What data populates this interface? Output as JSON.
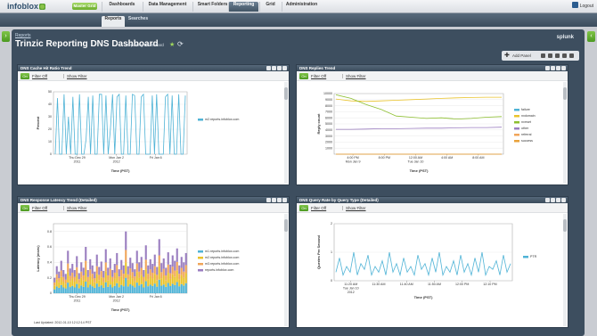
{
  "app": {
    "logo": "infoblox",
    "master_badge": "Master Grid",
    "logout": "Logout"
  },
  "nav": [
    {
      "label": "Dashboards",
      "active": false
    },
    {
      "label": "Data Management",
      "active": false
    },
    {
      "label": "Smart Folders",
      "active": false
    },
    {
      "label": "Reporting",
      "active": true
    },
    {
      "label": "Grid",
      "active": false
    },
    {
      "label": "Administration",
      "active": false
    }
  ],
  "subtabs": [
    {
      "label": "Reports",
      "active": true
    },
    {
      "label": "Searches",
      "active": false
    }
  ],
  "page": {
    "breadcrumb": "Reports",
    "title": "Trinzic Reporting DNS Dashboard",
    "sublabel": "Reporting Dashboard",
    "brand": "splunk",
    "add_panel": "Add Panel"
  },
  "filter": {
    "off": "Filter Off",
    "show": "Show Filter",
    "button": "On"
  },
  "panels": [
    {
      "title": "DNS Cache Hit Ratio Trend"
    },
    {
      "title": "DNS Replies Trend"
    },
    {
      "title": "DNS Response Latency Trend (Detailed)",
      "updated": "Last Updated: 2012-01-10 12:12:14 PST"
    },
    {
      "title": "DNS Query Rate by Query Type (Detailed)"
    }
  ],
  "colors": {
    "series_blue": "#4fb3d6",
    "series_yellow": "#e9c32c",
    "series_green": "#8dbf2f",
    "series_purple": "#9b7ec0",
    "series_orange": "#f0a55a",
    "series_teal": "#4fb3d6"
  },
  "chart_data": [
    {
      "type": "line",
      "title": "DNS Cache Hit Ratio Trend",
      "xlabel": "Time (PST)",
      "ylabel": "Percent",
      "ylim": [
        0,
        50
      ],
      "yticks": [
        0,
        10,
        20,
        30,
        40,
        50
      ],
      "xticks": [
        "Thu Dec 29\n2011",
        "Mon Jan 2\n2012",
        "Fri Jan 6"
      ],
      "series": [
        {
          "name": "m2.reports.infoblox.com",
          "color": "#4fb3d6",
          "values": [
            0,
            45,
            0,
            0,
            48,
            0,
            30,
            0,
            46,
            0,
            0,
            48,
            0,
            0,
            12,
            46,
            0,
            47,
            0,
            0,
            48,
            48,
            0,
            47,
            0,
            20,
            48,
            0,
            46,
            48,
            0,
            0,
            47,
            0,
            0,
            48,
            47,
            0,
            0,
            46,
            48,
            0,
            0,
            0,
            47,
            0,
            48,
            0,
            0,
            0,
            46,
            48,
            0,
            47,
            0,
            0,
            48,
            0,
            0,
            47
          ]
        }
      ]
    },
    {
      "type": "line",
      "title": "DNS Replies Trend",
      "xlabel": "Time (PST)",
      "ylabel": "Reply count",
      "ylim": [
        0,
        10000
      ],
      "yticks": [
        1000,
        2000,
        3000,
        4000,
        5000,
        6000,
        7000,
        8000,
        9000,
        10000
      ],
      "xticks": [
        "4:00 PM\nMon Jan 9",
        "8:00 PM",
        "12:00 AM\nTue Jan 10",
        "4:00 AM",
        "8:00 AM"
      ],
      "series": [
        {
          "name": "failure",
          "color": "#4fb3d6",
          "values": [
            0,
            0,
            0,
            0,
            0,
            0,
            0,
            0,
            0,
            0,
            0,
            0
          ]
        },
        {
          "name": "nxdomain",
          "color": "#e9c32c",
          "values": [
            9100,
            8800,
            8700,
            8800,
            8900,
            9000,
            9100,
            9200,
            9300,
            9350,
            9400,
            9400
          ]
        },
        {
          "name": "nxrrset",
          "color": "#8dbf2f",
          "values": [
            9800,
            9200,
            8200,
            7400,
            6300,
            6100,
            5900,
            6000,
            5800,
            5900,
            6100,
            6200
          ]
        },
        {
          "name": "other",
          "color": "#9b7ec0",
          "values": [
            4100,
            4100,
            4150,
            4200,
            4200,
            4250,
            4300,
            4300,
            4350,
            4400,
            4400,
            4450
          ]
        },
        {
          "name": "referral",
          "color": "#f0a55a",
          "values": [
            0,
            0,
            0,
            0,
            0,
            0,
            0,
            0,
            0,
            0,
            0,
            0
          ]
        },
        {
          "name": "success",
          "color": "#e9a23b",
          "values": [
            0,
            0,
            0,
            0,
            0,
            0,
            0,
            0,
            0,
            0,
            0,
            0
          ]
        }
      ]
    },
    {
      "type": "bar",
      "title": "DNS Response Latency Trend (Detailed)",
      "xlabel": "Time (PST)",
      "ylabel": "Latency (msec)",
      "ylim": [
        0,
        0.9
      ],
      "yticks": [
        0,
        0.2,
        0.4,
        0.6,
        0.8
      ],
      "xticks": [
        "Thu Dec 29\n2011",
        "Mon Jan 2\n2012",
        "Fri Jan 6"
      ],
      "series": [
        {
          "name": "m1.reports.infoblox.com",
          "color": "#4fb3d6"
        },
        {
          "name": "m2.reports.infoblox.com",
          "color": "#e9c32c"
        },
        {
          "name": "m3.reports.infoblox.com",
          "color": "#f0a55a"
        },
        {
          "name": "reports.infoblox.com",
          "color": "#9b7ec0"
        }
      ],
      "values": [
        0.2,
        0.35,
        0.28,
        0.42,
        0.3,
        0.25,
        0.55,
        0.32,
        0.38,
        0.3,
        0.48,
        0.26,
        0.4,
        0.33,
        0.6,
        0.3,
        0.44,
        0.36,
        0.28,
        0.5,
        0.34,
        0.41,
        0.29,
        0.57,
        0.33,
        0.45,
        0.3,
        0.38,
        0.52,
        0.31,
        0.43,
        0.36,
        0.8,
        0.35,
        0.46,
        0.39,
        0.31,
        0.55,
        0.4,
        0.47,
        0.3,
        0.62,
        0.36,
        0.44,
        0.38,
        0.5,
        0.34,
        0.7,
        0.39,
        0.45,
        0.33,
        0.53,
        0.37,
        0.49,
        0.42,
        0.58,
        0.36,
        0.47,
        0.4,
        0.52
      ]
    },
    {
      "type": "line",
      "title": "DNS Query Rate by Query Type (Detailed)",
      "xlabel": "Time (PST)",
      "ylabel": "Queries Per Second",
      "ylim": [
        0,
        2
      ],
      "yticks": [
        0,
        1,
        2
      ],
      "xticks": [
        "11:20 AM\nTue Jan 10\n2012",
        "11:30 AM",
        "11:40 AM",
        "11:50 AM",
        "12:00 PM",
        "12:10 PM"
      ],
      "series": [
        {
          "name": "PTR",
          "color": "#4fb3d6",
          "values": [
            0.3,
            0.8,
            0.2,
            0.5,
            0.3,
            1.0,
            0.2,
            0.6,
            0.4,
            0.9,
            0.2,
            0.5,
            0.3,
            0.7,
            0.2,
            1.0,
            0.3,
            0.6,
            0.2,
            0.8,
            0.3,
            0.5,
            0.2,
            0.9,
            0.4,
            0.6,
            0.2,
            0.8,
            0.3,
            1.0,
            0.2,
            0.5,
            0.3,
            0.7,
            0.2,
            0.9,
            0.3,
            0.6,
            0.2,
            0.8,
            0.3,
            1.0,
            0.2,
            0.5,
            0.4,
            0.7,
            0.2,
            0.9,
            0.3,
            0.6
          ]
        }
      ]
    }
  ]
}
